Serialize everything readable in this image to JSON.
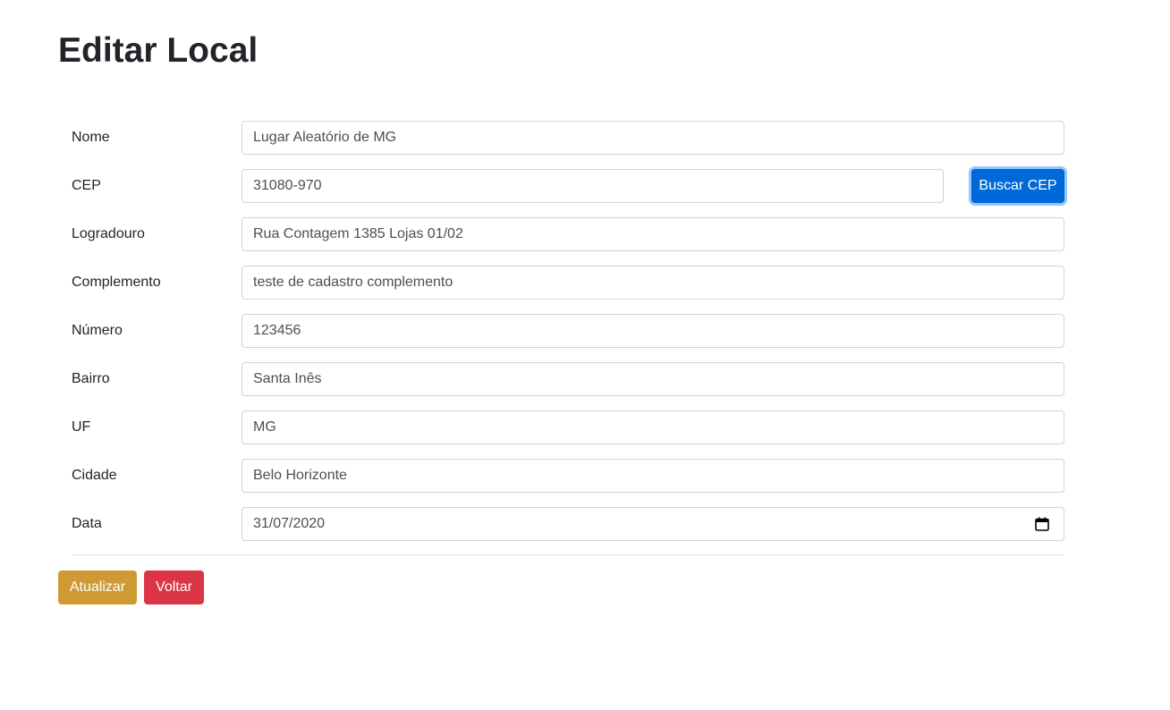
{
  "page": {
    "title": "Editar Local"
  },
  "form": {
    "fields": [
      {
        "label": "Nome",
        "value": "Lugar Aleatório de MG"
      },
      {
        "label": "CEP",
        "value": "31080-970"
      },
      {
        "label": "Logradouro",
        "value": "Rua Contagem 1385 Lojas 01/02"
      },
      {
        "label": "Complemento",
        "value": "teste de cadastro complemento"
      },
      {
        "label": "Número",
        "value": "123456"
      },
      {
        "label": "Bairro",
        "value": "Santa Inês"
      },
      {
        "label": "UF",
        "value": "MG"
      },
      {
        "label": "Cidade",
        "value": "Belo Horizonte"
      },
      {
        "label": "Data",
        "value": "31/07/2020"
      }
    ],
    "buscar_cep_label": "Buscar CEP",
    "date_icon": "calendar-icon"
  },
  "actions": {
    "update_label": "Atualizar",
    "back_label": "Voltar"
  },
  "colors": {
    "primary": "#0069d9",
    "warning": "#cf9a34",
    "danger": "#dc3545"
  }
}
